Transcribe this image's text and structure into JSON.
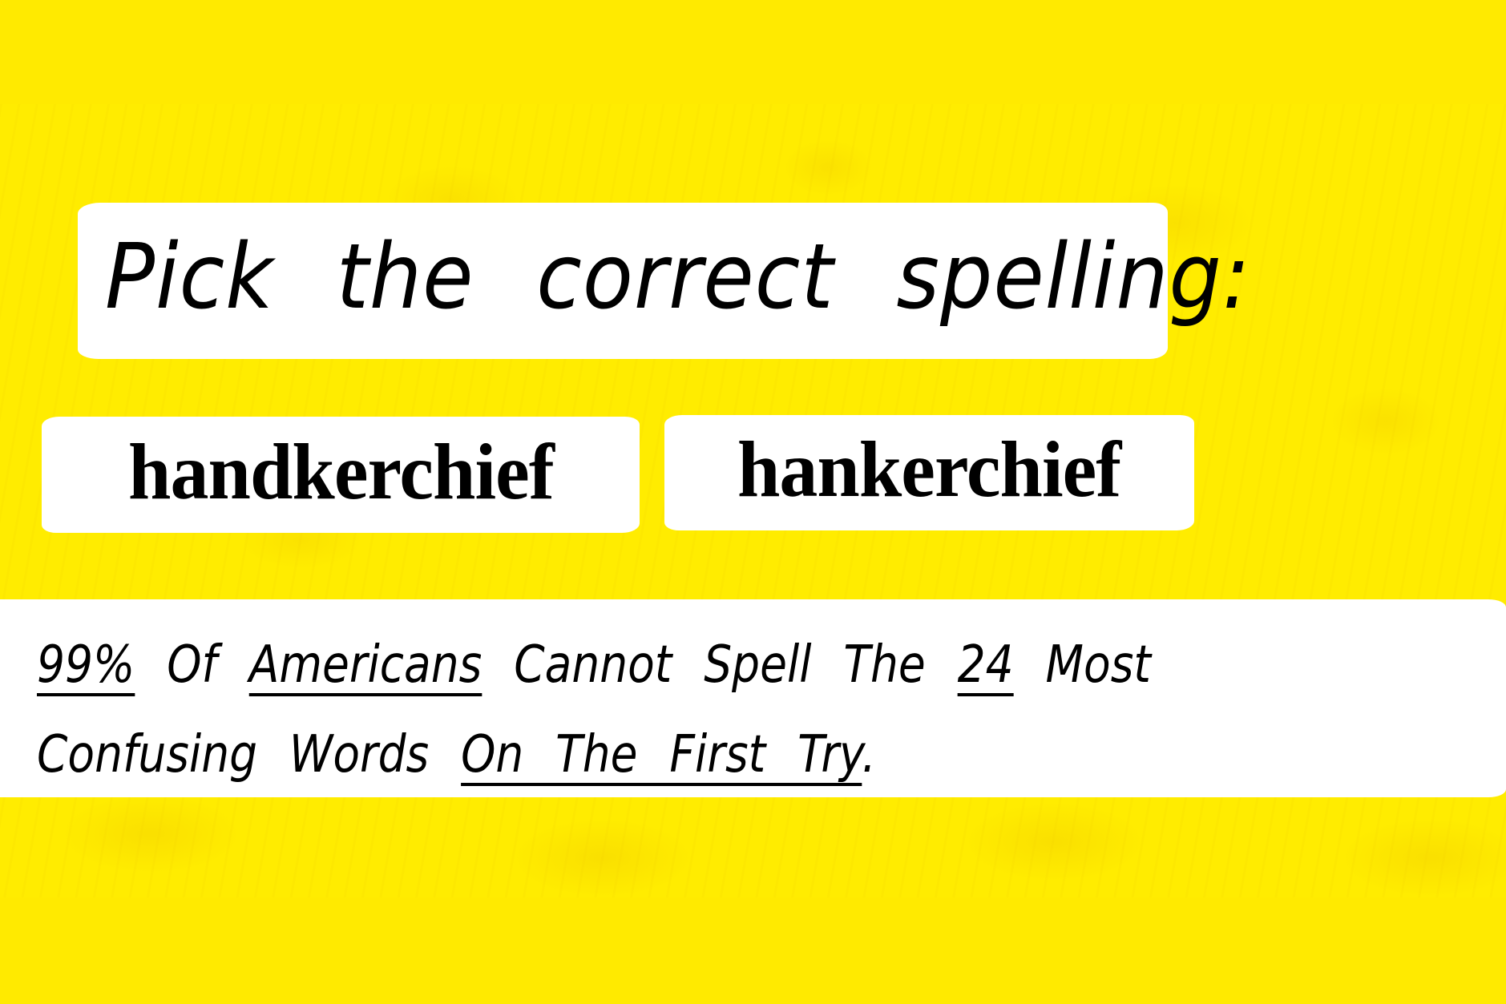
{
  "colors": {
    "background": "#ffea00",
    "box": "#ffffff",
    "text": "#000000"
  },
  "question": {
    "title": "Pick the correct spelling:"
  },
  "options": [
    {
      "label": "handkerchief"
    },
    {
      "label": "hankerchief"
    }
  ],
  "banner": {
    "line1": [
      {
        "text": "99%",
        "underline": true
      },
      {
        "text": " Of ",
        "underline": false
      },
      {
        "text": "Americans",
        "underline": true
      },
      {
        "text": " Cannot Spell The ",
        "underline": false
      },
      {
        "text": "24",
        "underline": true
      },
      {
        "text": " Most",
        "underline": false
      }
    ],
    "line2": [
      {
        "text": "Confusing Words ",
        "underline": false
      },
      {
        "text": "On The First Try",
        "underline": true
      },
      {
        "text": ".",
        "underline": false
      }
    ]
  }
}
